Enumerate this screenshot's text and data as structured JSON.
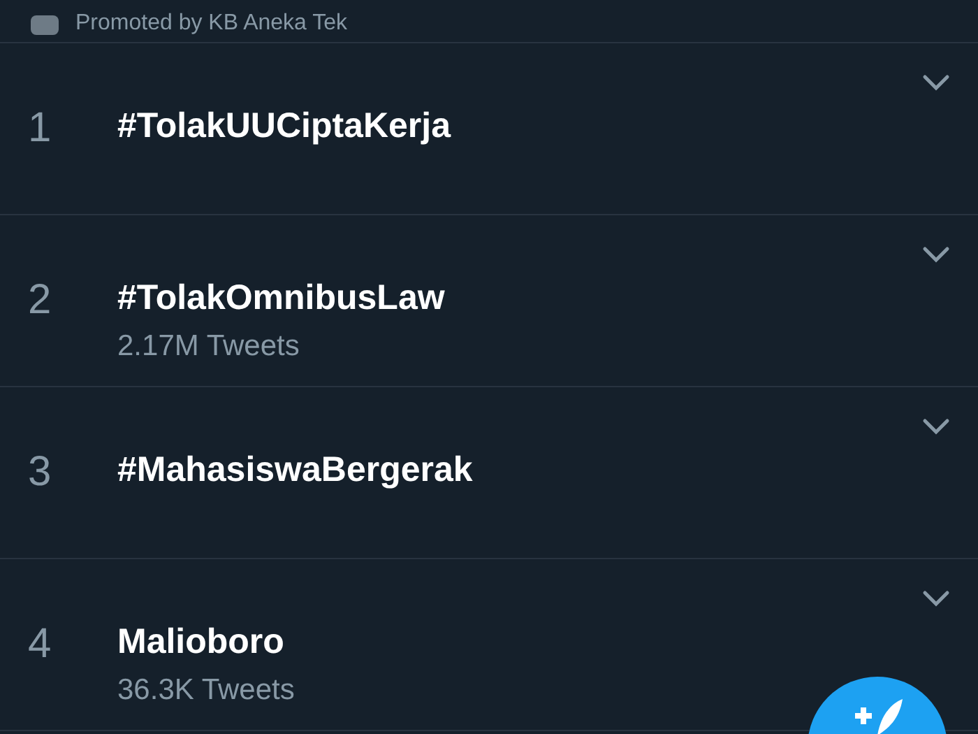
{
  "promoted": {
    "text": "Promoted by KB Aneka Tek"
  },
  "trends": [
    {
      "rank": "1",
      "name": "#TolakUUCiptaKerja"
    },
    {
      "rank": "2",
      "name": "#TolakOmnibusLaw",
      "count": "2.17M Tweets"
    },
    {
      "rank": "3",
      "name": "#MahasiswaBergerak"
    },
    {
      "rank": "4",
      "name": "Malioboro",
      "count": "36.3K Tweets"
    }
  ]
}
